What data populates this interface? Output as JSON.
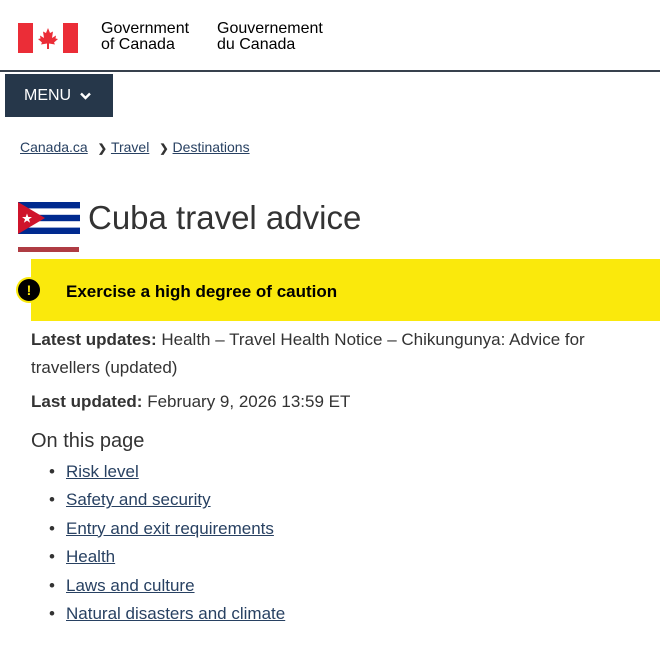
{
  "header": {
    "signature_en_line1": "Government",
    "signature_en_line2": "of Canada",
    "signature_fr_line1": "Gouvernement",
    "signature_fr_line2": "du Canada",
    "flag_icon": "canada-flag-icon"
  },
  "menu": {
    "label": "MENU",
    "icon": "chevron-down-icon"
  },
  "breadcrumb": {
    "items": [
      "Canada.ca",
      "Travel",
      "Destinations"
    ]
  },
  "page": {
    "title": "Cuba travel advice",
    "flag_icon": "cuba-flag-icon",
    "warning": {
      "icon": "exclamation-icon",
      "text": "Exercise a high degree of caution",
      "color": "#fae90c"
    },
    "latest_updates_label": "Latest updates:",
    "latest_updates_text": "Health – Travel Health Notice – Chikungunya: Advice for travellers (updated)",
    "last_updated_label": "Last updated:",
    "last_updated_value": "February 9, 2026 13:59 ET"
  },
  "on_this_page": {
    "heading": "On this page",
    "items": [
      "Risk level",
      "Safety and security",
      "Entry and exit requirements",
      "Health",
      "Laws and culture",
      "Natural disasters and climate"
    ]
  }
}
